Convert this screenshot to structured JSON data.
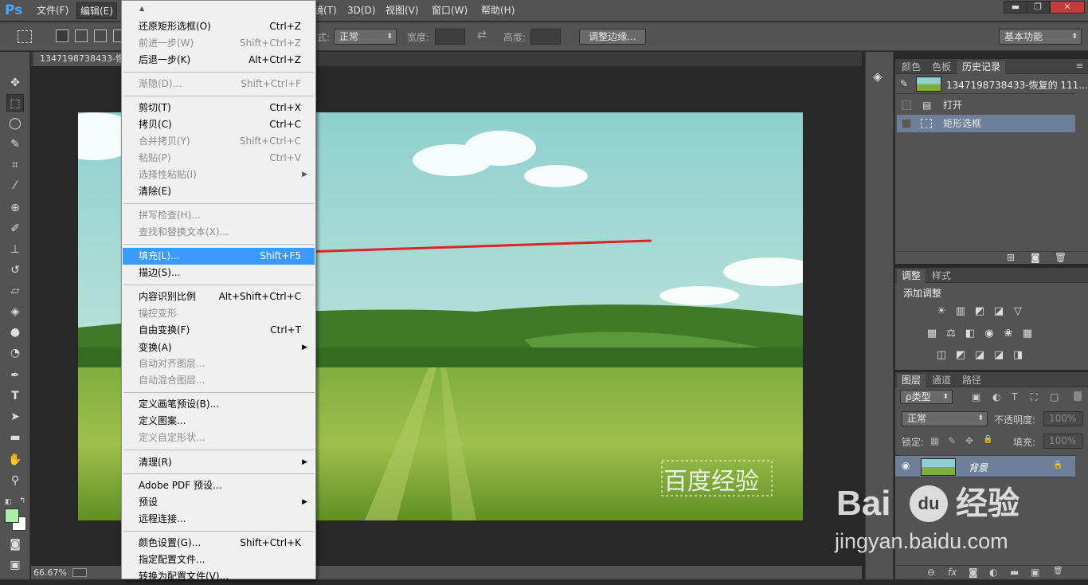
{
  "app": {
    "logo": "Ps",
    "menus": [
      "文件(F)",
      "编辑(E)",
      "镜(T)",
      "3D(D)",
      "视图(V)",
      "窗口(W)",
      "帮助(H)"
    ],
    "window_controls": [
      "▬",
      "❐",
      "✕"
    ]
  },
  "options": {
    "style_label": "式:",
    "style_value": "正常",
    "width_label": "宽度:",
    "height_label": "高度:",
    "refine_button": "调整边缘...",
    "workspace": "基本功能"
  },
  "document": {
    "tab_title": "1347198738433-恢",
    "zoom": "66.67%",
    "watermark_text": "百度经验"
  },
  "history_panel": {
    "tabs": [
      "颜色",
      "色板",
      "历史记录"
    ],
    "snapshot_label": "1347198738433-恢复的 111...",
    "items": [
      "打开",
      "矩形选框"
    ]
  },
  "adjust_panel": {
    "tabs": [
      "调整",
      "样式"
    ],
    "title": "添加调整",
    "row1": [
      "☀",
      "▥",
      "◩",
      "◪",
      "▽"
    ],
    "row2": [
      "▦",
      "⚖",
      "◧",
      "◉",
      "❀",
      "▦"
    ],
    "row3": [
      "◫",
      "◩",
      "◪",
      "◪",
      "◨"
    ]
  },
  "layers_panel": {
    "tabs": [
      "图层",
      "通道",
      "路径"
    ],
    "filter_label": "ρ类型",
    "filter_icons": [
      "▣",
      "◐",
      "T",
      "⛶",
      "▢"
    ],
    "blend_mode": "正常",
    "opacity_label": "不透明度:",
    "opacity_value": "100%",
    "lock_label": "锁定:",
    "lock_icons": [
      "▦",
      "✎",
      "✥",
      "🔒"
    ],
    "fill_label": "填充:",
    "fill_value": "100%",
    "layer_name": "背景",
    "bottom_icons": [
      "⊖",
      "fx",
      "◙",
      "◐",
      "▬",
      "▣",
      "🗑"
    ]
  },
  "edit_menu": {
    "items": [
      {
        "label": "还原矩形选框(O)",
        "shortcut": "Ctrl+Z",
        "disabled": false
      },
      {
        "label": "前进一步(W)",
        "shortcut": "Shift+Ctrl+Z",
        "disabled": true
      },
      {
        "label": "后退一步(K)",
        "shortcut": "Alt+Ctrl+Z",
        "disabled": false
      },
      {
        "label": "渐隐(D)...",
        "shortcut": "Shift+Ctrl+F",
        "disabled": true
      },
      {
        "label": "剪切(T)",
        "shortcut": "Ctrl+X",
        "disabled": false
      },
      {
        "label": "拷贝(C)",
        "shortcut": "Ctrl+C",
        "disabled": false
      },
      {
        "label": "合并拷贝(Y)",
        "shortcut": "Shift+Ctrl+C",
        "disabled": true
      },
      {
        "label": "粘贴(P)",
        "shortcut": "Ctrl+V",
        "disabled": true
      },
      {
        "label": "选择性粘贴(I)",
        "shortcut": "",
        "disabled": true,
        "submenu": true
      },
      {
        "label": "清除(E)",
        "shortcut": "",
        "disabled": false
      },
      {
        "label": "拼写检查(H)...",
        "shortcut": "",
        "disabled": true
      },
      {
        "label": "查找和替换文本(X)...",
        "shortcut": "",
        "disabled": true
      },
      {
        "label": "填充(L)...",
        "shortcut": "Shift+F5",
        "disabled": false,
        "highlighted": true
      },
      {
        "label": "描边(S)...",
        "shortcut": "",
        "disabled": false
      },
      {
        "label": "内容识别比例",
        "shortcut": "Alt+Shift+Ctrl+C",
        "disabled": false
      },
      {
        "label": "操控变形",
        "shortcut": "",
        "disabled": true
      },
      {
        "label": "自由变换(F)",
        "shortcut": "Ctrl+T",
        "disabled": false
      },
      {
        "label": "变换(A)",
        "shortcut": "",
        "disabled": false,
        "submenu": true
      },
      {
        "label": "自动对齐图层...",
        "shortcut": "",
        "disabled": true
      },
      {
        "label": "自动混合图层...",
        "shortcut": "",
        "disabled": true
      },
      {
        "label": "定义画笔预设(B)...",
        "shortcut": "",
        "disabled": false
      },
      {
        "label": "定义图案...",
        "shortcut": "",
        "disabled": false
      },
      {
        "label": "定义自定形状...",
        "shortcut": "",
        "disabled": true
      },
      {
        "label": "清理(R)",
        "shortcut": "",
        "disabled": false,
        "submenu": true
      },
      {
        "label": "Adobe PDF 预设...",
        "shortcut": "",
        "disabled": false
      },
      {
        "label": "预设",
        "shortcut": "",
        "disabled": false,
        "submenu": true
      },
      {
        "label": "远程连接...",
        "shortcut": "",
        "disabled": false
      },
      {
        "label": "颜色设置(G)...",
        "shortcut": "Shift+Ctrl+K",
        "disabled": false
      },
      {
        "label": "指定配置文件...",
        "shortcut": "",
        "disabled": false
      },
      {
        "label": "转换为配置文件(V)...",
        "shortcut": "",
        "disabled": false
      }
    ]
  },
  "baidu_watermark": {
    "brand": "Bai",
    "paw": "du",
    "cn": "经验",
    "url": "jingyan.baidu.com"
  },
  "colors": {
    "accent": "#3b99fc",
    "foreground_swatch": "#a9f0a9",
    "arrow": "#e0232a",
    "selected_row": "#6d7f99"
  }
}
